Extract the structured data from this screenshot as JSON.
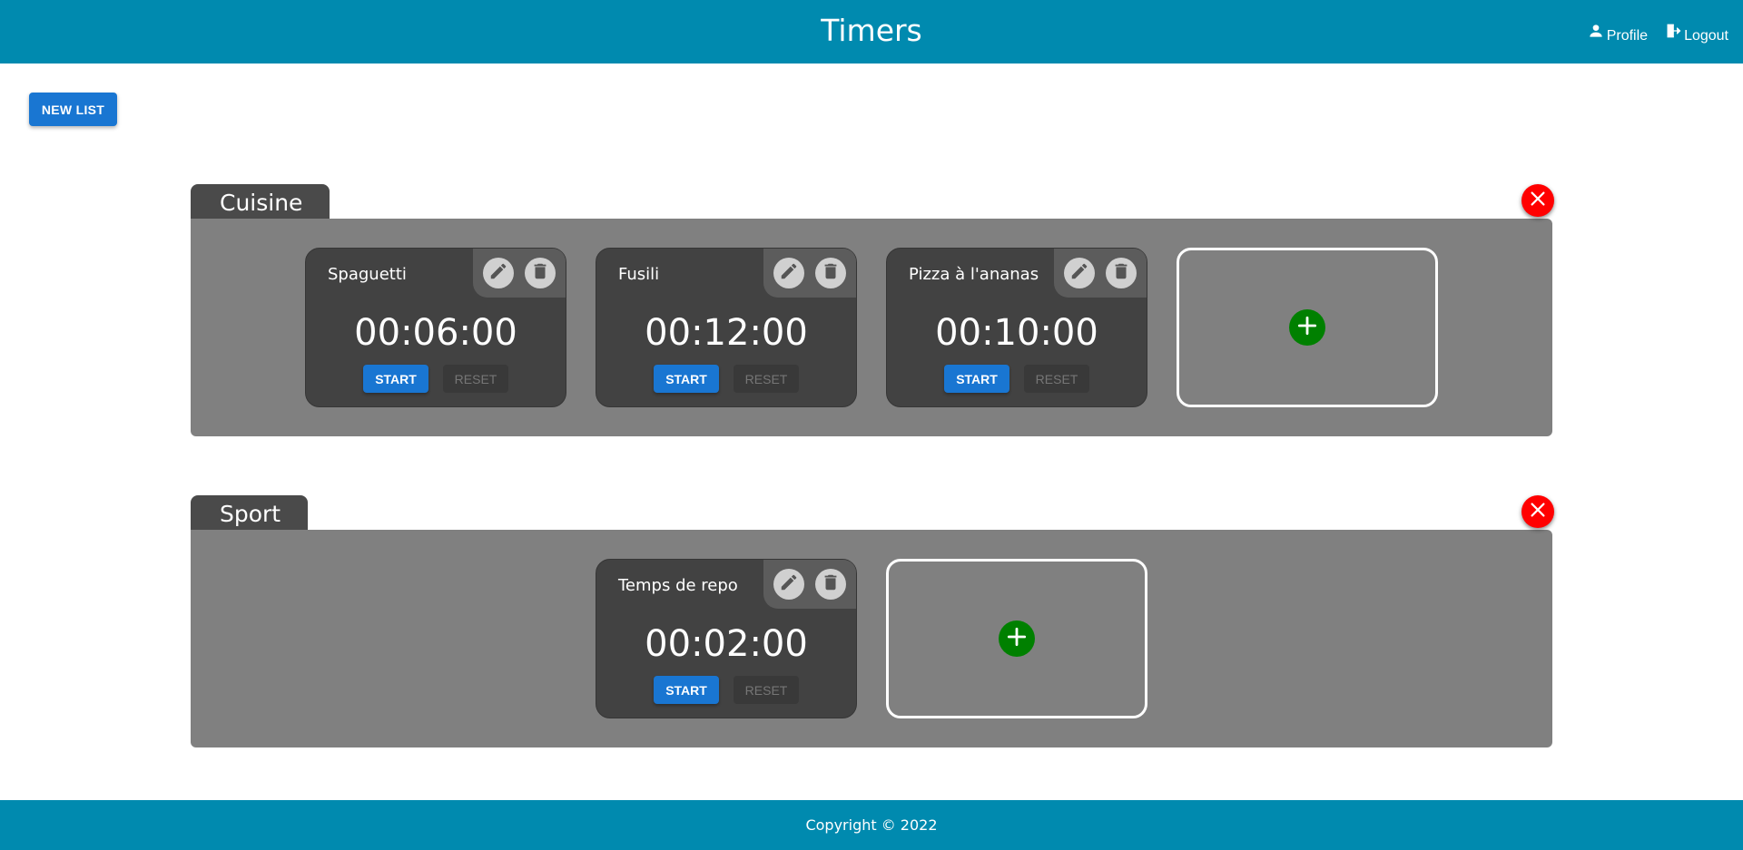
{
  "header": {
    "title": "Timers",
    "profile_label": "Profile",
    "logout_label": "Logout"
  },
  "toolbar": {
    "new_list_label": "NEW LIST"
  },
  "lists": [
    {
      "name": "Cuisine",
      "timers": [
        {
          "name": "Spaguetti",
          "time": "00:06:00"
        },
        {
          "name": "Fusili",
          "time": "00:12:00"
        },
        {
          "name": "Pizza à l'ananas",
          "time": "00:10:00"
        }
      ]
    },
    {
      "name": "Sport",
      "timers": [
        {
          "name": "Temps de repo",
          "time": "00:02:00"
        }
      ]
    }
  ],
  "timer_buttons": {
    "start_label": "START",
    "reset_label": "RESET"
  },
  "footer": {
    "copyright": "Copyright © 2022"
  },
  "colors": {
    "header": "#008aaf",
    "primary": "#1976d2",
    "danger": "#ff0000",
    "add": "#008000"
  }
}
